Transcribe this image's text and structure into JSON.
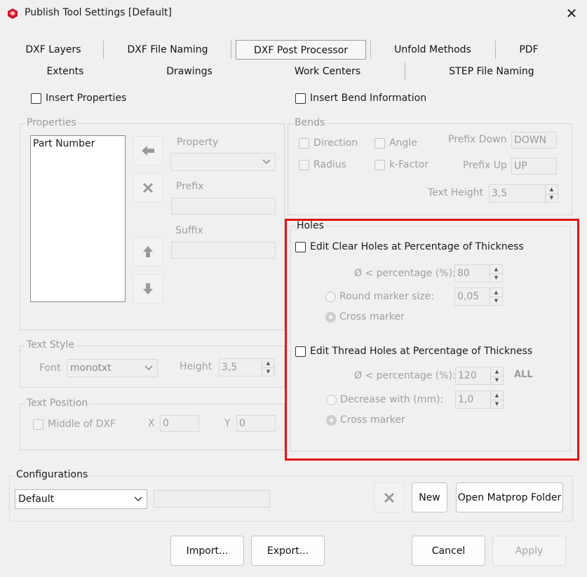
{
  "window": {
    "title": "Publish Tool Settings  [Default]",
    "close_glyph": "✕"
  },
  "tabs": {
    "row1": [
      "DXF Layers",
      "DXF File Naming",
      "DXF Post Processor",
      "Unfold Methods",
      "PDF"
    ],
    "row2": [
      "Extents",
      "Drawings",
      "Work Centers",
      "STEP File Naming"
    ],
    "active": "DXF Post Processor"
  },
  "insert_properties": "Insert Properties",
  "insert_bend_information": "Insert Bend Information",
  "properties": {
    "title": "Properties",
    "list_items": [
      "Part Number"
    ],
    "property_label": "Property",
    "prefix_label": "Prefix",
    "suffix_label": "Suffix"
  },
  "bends": {
    "title": "Bends",
    "direction": "Direction",
    "angle": "Angle",
    "radius": "Radius",
    "kfactor": "k-Factor",
    "prefix_down_label": "Prefix Down",
    "prefix_down_value": "DOWN",
    "prefix_up_label": "Prefix Up",
    "prefix_up_value": "UP",
    "text_height_label": "Text Height",
    "text_height_value": "3,5"
  },
  "holes": {
    "title": "Holes",
    "clear_check": "Edit Clear Holes at Percentage of Thickness",
    "clear_pct_label": "Ø < percentage (%):",
    "clear_pct_value": "80",
    "round_marker_label": "Round marker size:",
    "round_marker_value": "0,05",
    "cross_marker_1": "Cross marker",
    "thread_check": "Edit Thread Holes at Percentage of Thickness",
    "thread_pct_label": "Ø < percentage (%):",
    "thread_pct_value": "120",
    "all_label": "ALL",
    "decrease_label": "Decrease with (mm):",
    "decrease_value": "1,0",
    "cross_marker_2": "Cross marker"
  },
  "text_style": {
    "title": "Text Style",
    "font_label": "Font",
    "font_value": "monotxt",
    "height_label": "Height",
    "height_value": "3,5"
  },
  "text_position": {
    "title": "Text Position",
    "middle_of_dxf": "Middle of DXF",
    "x_label": "X",
    "x_value": "0",
    "y_label": "Y",
    "y_value": "0"
  },
  "configurations": {
    "title": "Configurations",
    "selected": "Default",
    "new_label": "New",
    "open_matprop_label": "Open Matprop Folder"
  },
  "footer": {
    "import_label": "Import...",
    "export_label": "Export...",
    "cancel_label": "Cancel",
    "apply_label": "Apply"
  },
  "colors": {
    "highlight_rect": "#e01414",
    "app_icon": "#c8102e"
  }
}
